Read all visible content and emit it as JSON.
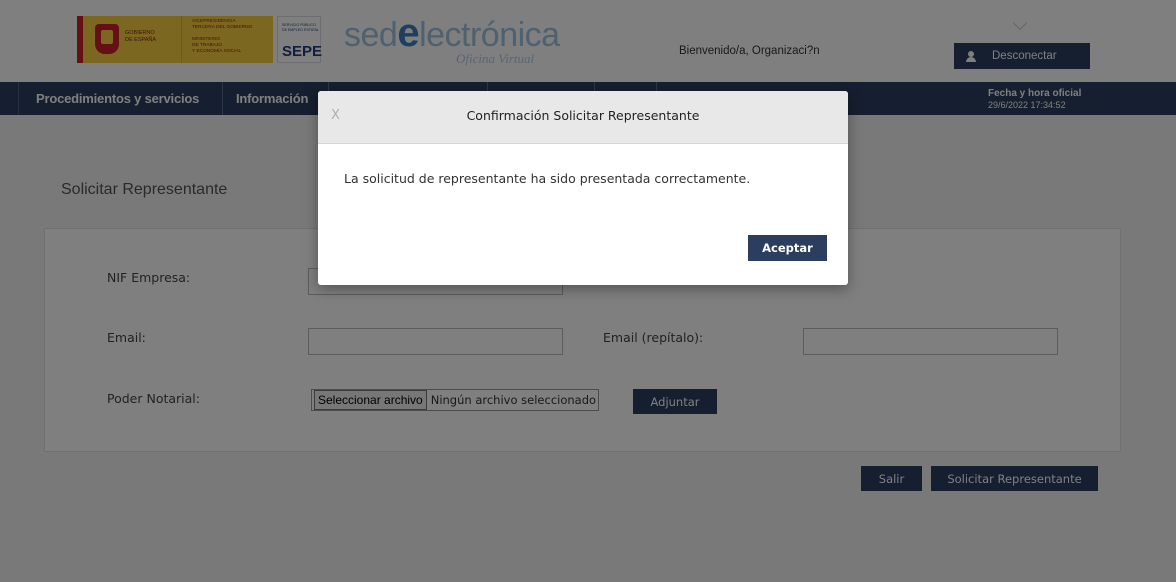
{
  "header": {
    "gov_logo_alt": "Gobierno de España - Vicepresidencia Tercera del Gobierno - Ministerio de Trabajo y Economía Social",
    "gov_text": "GOBIERNO\nDE ESPAÑA",
    "ministry_text": "VICEPRESIDENCIA\nTERCERA DEL GOBIERNO\n\nMINISTERIO\nDE TRABAJO\nY ECONOMÍA SOCIAL",
    "sepe_small": "SERVICIO PÚBLICO\nDE EMPLEO ESTATAL",
    "sepe_label": "SEPE",
    "site_logo_pre": "sed",
    "site_logo_e": "e",
    "site_logo_post": "lectrónica",
    "site_logo_sub": "Oficina Virtual",
    "welcome": "Bienvenido/a, Organizaci?n",
    "logout_label": "Desconectar",
    "user_icon": "user-icon"
  },
  "nav": {
    "items": [
      {
        "label": "Procedimientos y servicios"
      },
      {
        "label": "Información"
      }
    ],
    "datetime_label": "Fecha y hora oficial",
    "datetime_value": "29/6/2022 17:34:52"
  },
  "main": {
    "page_title": "Solicitar Representante",
    "fields": {
      "nif_label": "NIF Empresa:",
      "nif_value": "",
      "email_label": "Email:",
      "email_value": "",
      "email_repeat_label": "Email (repítalo):",
      "email_repeat_value": "",
      "poder_label": "Poder Notarial:",
      "file_button": "Seleccionar archivo",
      "file_status": "Ningún archivo seleccionado",
      "attach_button": "Adjuntar"
    },
    "actions": {
      "exit_label": "Salir",
      "submit_label": "Solicitar Representante"
    }
  },
  "modal": {
    "close_glyph": "X",
    "title": "Confirmación Solicitar Representante",
    "message": "La solicitud de representante ha sido presentada correctamente.",
    "accept_label": "Aceptar"
  },
  "colors": {
    "brand_navy": "#2c3e5f",
    "overlay": "rgba(0,0,0,0.5)"
  }
}
